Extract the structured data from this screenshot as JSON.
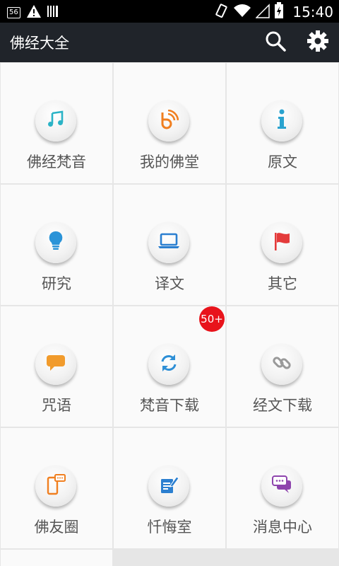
{
  "status_bar": {
    "notification_badge": "56",
    "time": "15:40",
    "icons": [
      "warning-icon",
      "barcode-icon",
      "vibrate-icon",
      "wifi-icon",
      "signal-icon",
      "battery-icon"
    ]
  },
  "action_bar": {
    "title": "佛经大全",
    "actions": [
      "search-icon",
      "gear-icon"
    ]
  },
  "grid": {
    "tiles": [
      {
        "label": "佛经梵音",
        "icon": "music-note-icon",
        "color": "#2bb3c6"
      },
      {
        "label": "我的佛堂",
        "icon": "rss-b-icon",
        "color": "#f07f20"
      },
      {
        "label": "原文",
        "icon": "info-icon",
        "color": "#2aa3cf"
      },
      {
        "label": "研究",
        "icon": "lightbulb-icon",
        "color": "#2a93d8"
      },
      {
        "label": "译文",
        "icon": "laptop-icon",
        "color": "#2b7fd0"
      },
      {
        "label": "其它",
        "icon": "flag-icon",
        "color": "#e43b3b"
      },
      {
        "label": "咒语",
        "icon": "chat-bubble-icon",
        "color": "#f19b2c"
      },
      {
        "label": "梵音下载",
        "icon": "refresh-icon",
        "color": "#2e8fd6"
      },
      {
        "label": "经文下载",
        "icon": "link-icon",
        "color": "#9a9a9a"
      },
      {
        "label": "佛友圈",
        "icon": "phone-message-icon",
        "color": "#f07f20"
      },
      {
        "label": "忏悔室",
        "icon": "edit-note-icon",
        "color": "#2b7fd0"
      },
      {
        "label": "消息中心",
        "icon": "chat-bubbles-icon",
        "color": "#8e44ad"
      }
    ],
    "download_badge": "50+"
  }
}
